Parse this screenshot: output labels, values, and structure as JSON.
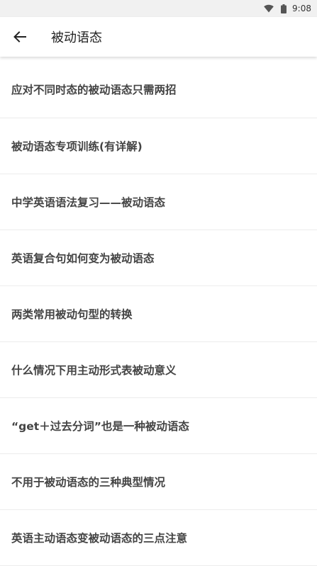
{
  "status_bar": {
    "time": "9:08"
  },
  "header": {
    "title": "被动语态"
  },
  "articles": [
    {
      "title": "应对不同时态的被动语态只需两招"
    },
    {
      "title": "被动语态专项训练(有详解)"
    },
    {
      "title": "中学英语语法复习——被动语态"
    },
    {
      "title": "英语复合句如何变为被动语态"
    },
    {
      "title": "两类常用被动句型的转换"
    },
    {
      "title": "什么情况下用主动形式表被动意义"
    },
    {
      "title": "“get＋过去分词”也是一种被动语态"
    },
    {
      "title": "不用于被动语态的三种典型情况"
    },
    {
      "title": "英语主动语态变被动语态的三点注意"
    }
  ]
}
